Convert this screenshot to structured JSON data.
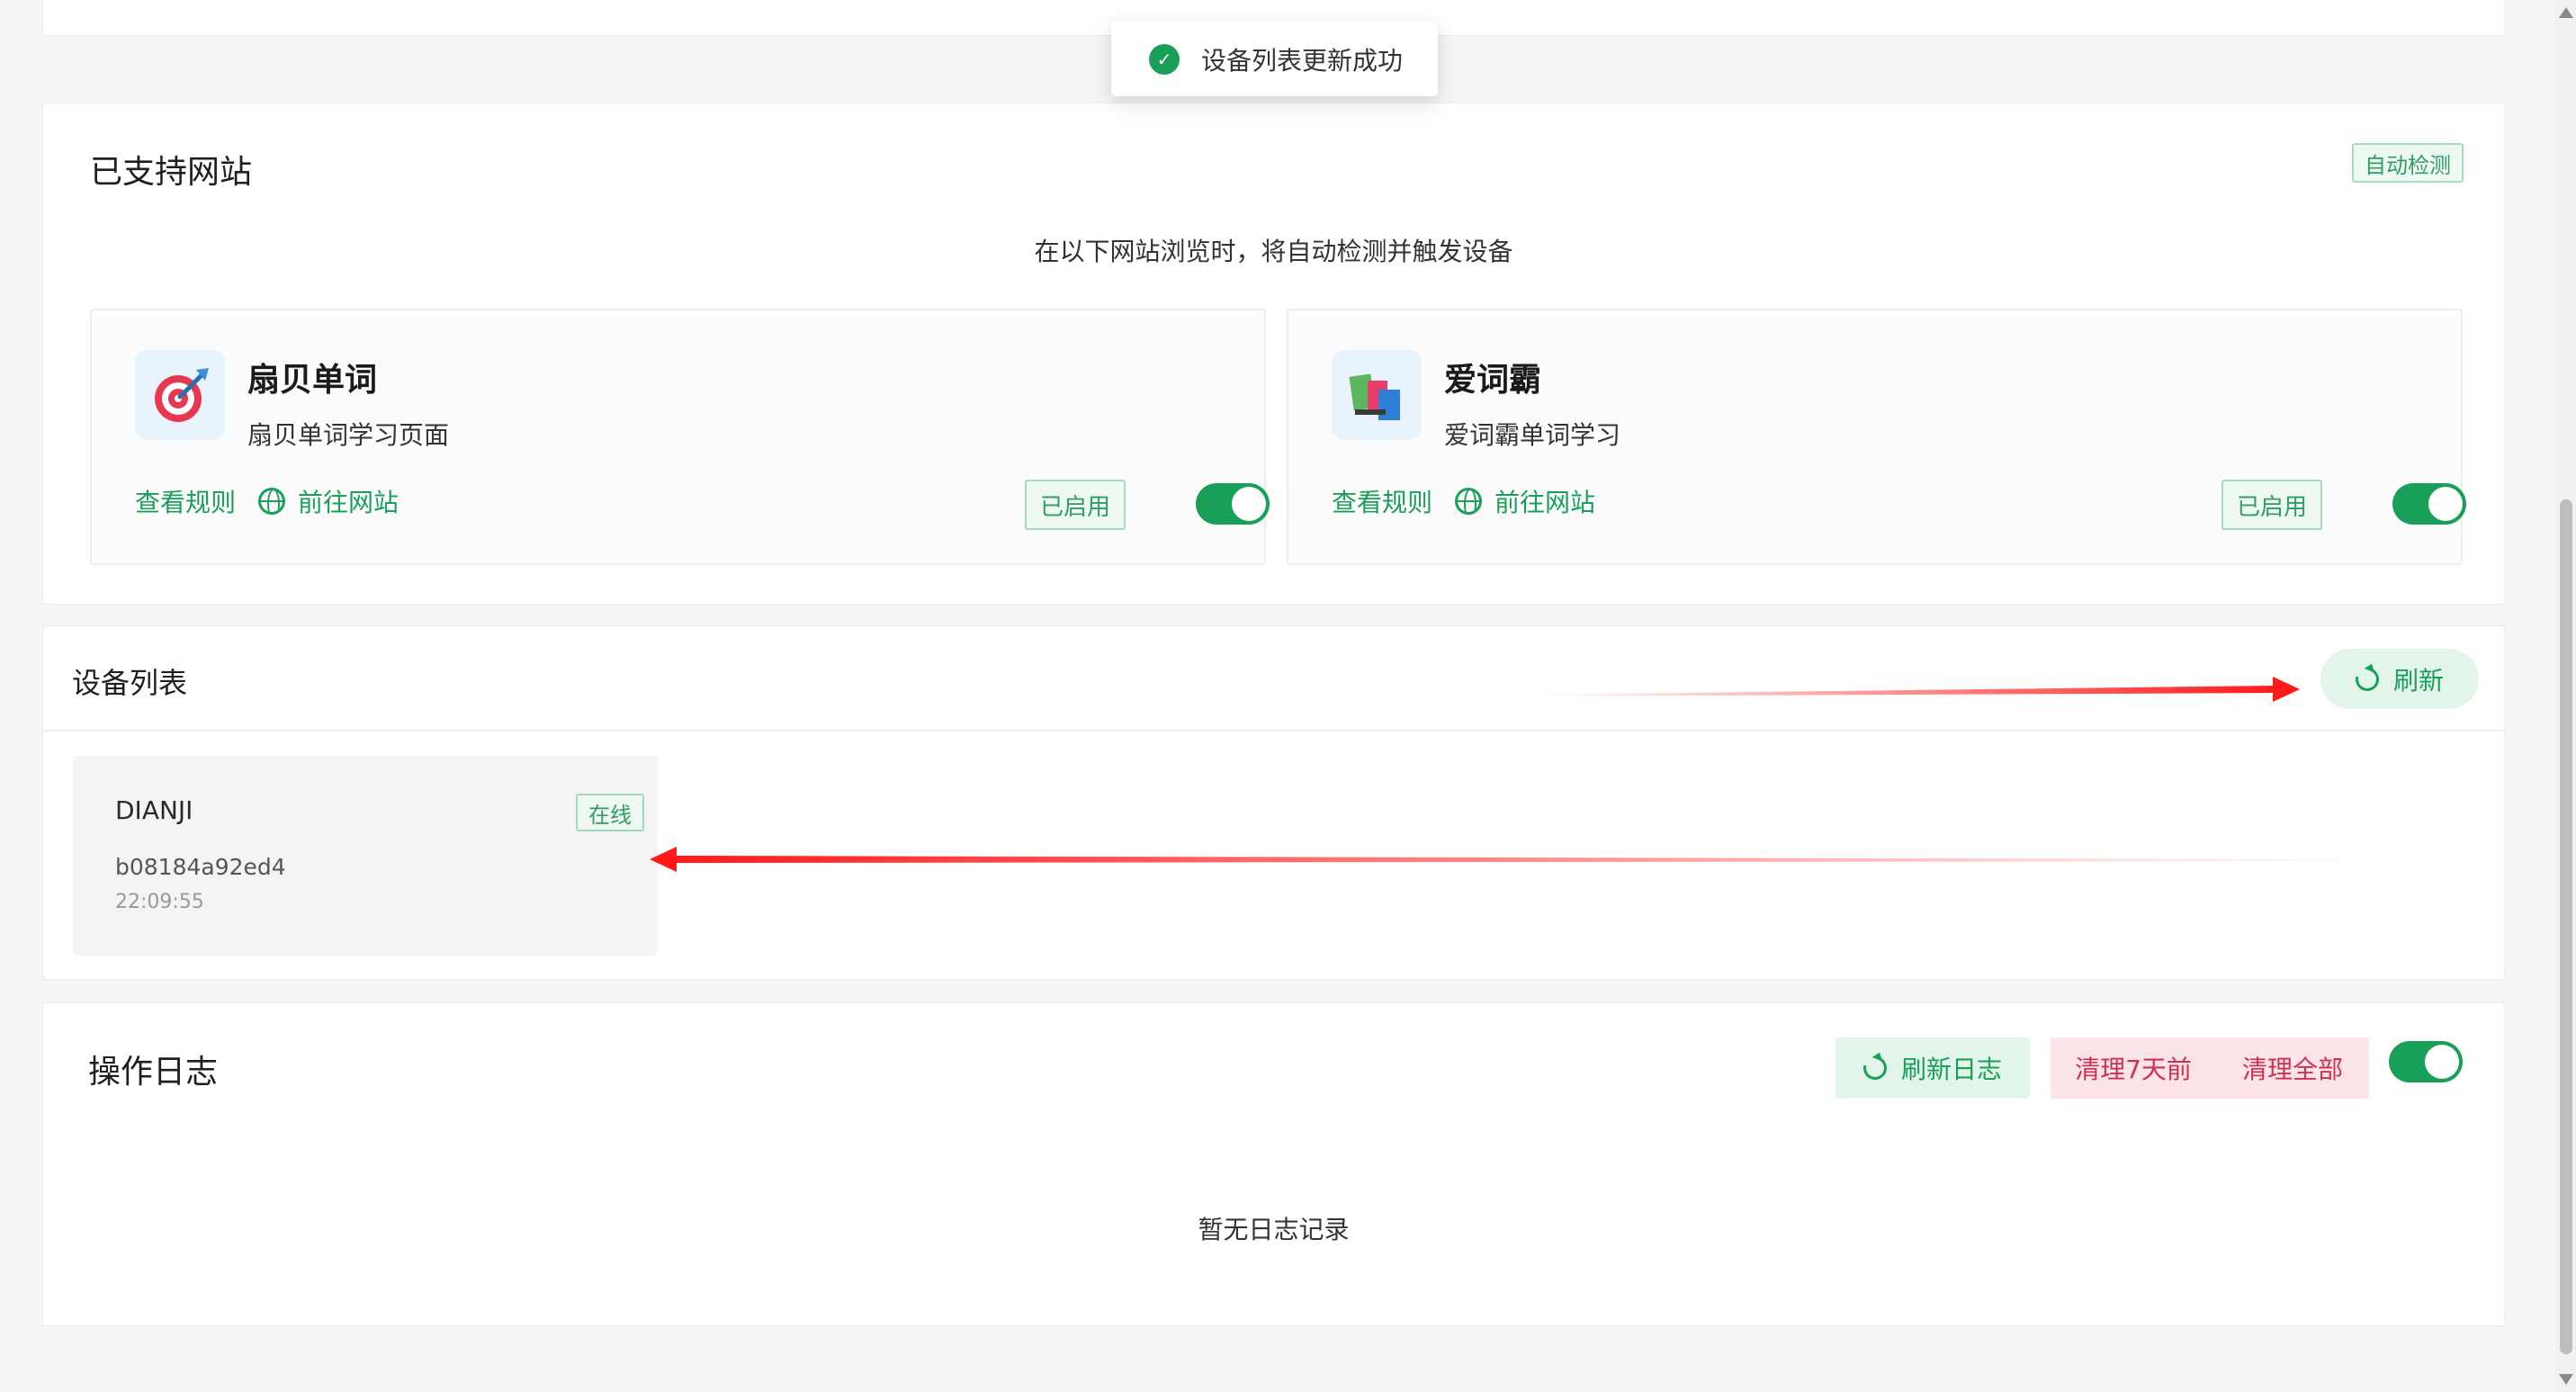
{
  "toast": {
    "message": "设备列表更新成功"
  },
  "sites": {
    "title": "已支持网站",
    "badge": "自动检测",
    "subtitle": "在以下网站浏览时，将自动检测并触发设备",
    "items": [
      {
        "name": "扇贝单词",
        "description": "扇贝单词学习页面",
        "view_rules": "查看规则",
        "visit_site": "前往网站",
        "status": "已启用",
        "enabled": true,
        "icon": "target-icon"
      },
      {
        "name": "爱词霸",
        "description": "爱词霸单词学习",
        "view_rules": "查看规则",
        "visit_site": "前往网站",
        "status": "已启用",
        "enabled": true,
        "icon": "books-icon"
      }
    ]
  },
  "devices": {
    "title": "设备列表",
    "refresh_label": "刷新",
    "items": [
      {
        "name": "DIANJI",
        "status": "在线",
        "id": "b08184a92ed4",
        "time": "22:09:55"
      }
    ]
  },
  "logs": {
    "title": "操作日志",
    "refresh_label": "刷新日志",
    "clear_7days_label": "清理7天前",
    "clear_all_label": "清理全部",
    "auto_enabled": true,
    "empty_text": "暂无日志记录"
  },
  "colors": {
    "primary": "#18a058",
    "danger": "#d03050",
    "annotation": "#ff1a1a"
  }
}
